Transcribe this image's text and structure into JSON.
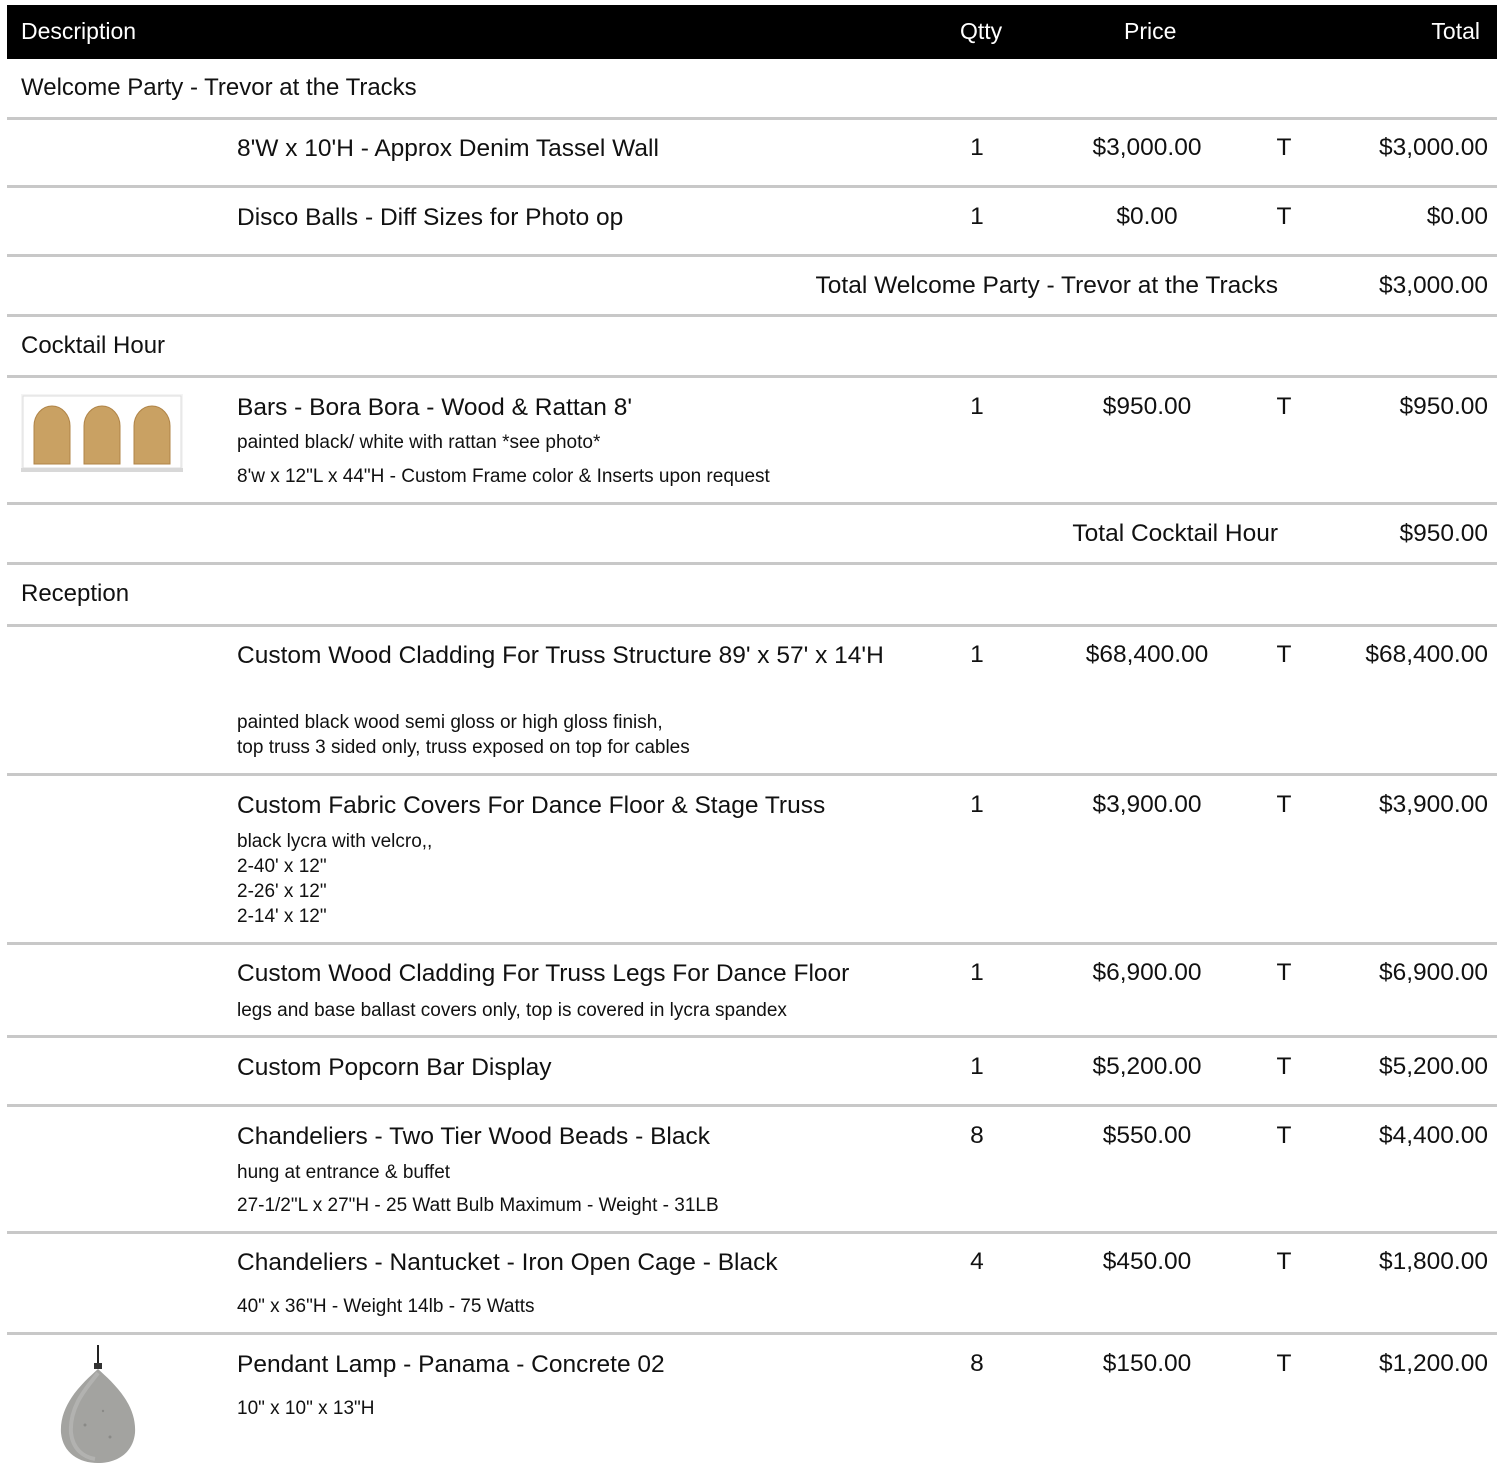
{
  "header": {
    "description": "Description",
    "qty": "Qtty",
    "price": "Price",
    "total": "Total"
  },
  "sections": [
    {
      "name": "Welcome Party - Trevor at the Tracks",
      "items": [
        {
          "title": "8'W x 10'H - Approx Denim Tassel Wall",
          "desc": [],
          "qty": "1",
          "price": "$3,000.00",
          "tax": "T",
          "total": "$3,000.00"
        },
        {
          "title": "Disco Balls - Diff Sizes for Photo op",
          "desc": [],
          "qty": "1",
          "price": "$0.00",
          "tax": "T",
          "total": "$0.00"
        }
      ],
      "subtotal_label": "Total Welcome Party - Trevor at the Tracks",
      "subtotal": "$3,000.00"
    },
    {
      "name": "Cocktail Hour",
      "items": [
        {
          "title": "Bars - Bora Bora - Wood & Rattan 8'",
          "desc": [
            "painted black/ white with rattan *see photo*",
            "8'w x 12\"L x 44\"H  - Custom Frame color & Inserts upon request"
          ],
          "qty": "1",
          "price": "$950.00",
          "tax": "T",
          "total": "$950.00",
          "image": "rattan-bar-photo"
        }
      ],
      "subtotal_label": "Total Cocktail Hour",
      "subtotal": "$950.00"
    },
    {
      "name": "Reception",
      "items": [
        {
          "title": "Custom Wood Cladding For Truss Structure 89' x 57' x 14'H",
          "desc": [
            "painted black wood semi gloss or high gloss finish,",
            "top truss 3 sided only, truss exposed on top for cables"
          ],
          "qty": "1",
          "price": "$68,400.00",
          "tax": "T",
          "total": "$68,400.00"
        },
        {
          "title": "Custom Fabric Covers For Dance Floor & Stage Truss",
          "desc": [
            "black lycra with velcro,,",
            "2-40' x 12\"",
            "2-26' x 12\"",
            "2-14' x 12\""
          ],
          "qty": "1",
          "price": "$3,900.00",
          "tax": "T",
          "total": "$3,900.00"
        },
        {
          "title": "Custom Wood Cladding For Truss Legs For Dance Floor",
          "desc": [
            "legs and base ballast covers only, top is covered in lycra spandex"
          ],
          "qty": "1",
          "price": "$6,900.00",
          "tax": "T",
          "total": "$6,900.00"
        },
        {
          "title": "Custom Popcorn Bar Display",
          "desc": [],
          "qty": "1",
          "price": "$5,200.00",
          "tax": "T",
          "total": "$5,200.00"
        },
        {
          "title": "Chandeliers - Two Tier Wood Beads - Black",
          "desc": [
            "hung at entrance & buffet",
            "27-1/2\"L x 27\"H - 25 Watt Bulb Maximum - Weight - 31LB"
          ],
          "qty": "8",
          "price": "$550.00",
          "tax": "T",
          "total": "$4,400.00"
        },
        {
          "title": "Chandeliers - Nantucket - Iron Open Cage - Black",
          "desc": [
            "40\" x 36\"H - Weight 14lb - 75 Watts"
          ],
          "qty": "4",
          "price": "$450.00",
          "tax": "T",
          "total": "$1,800.00"
        },
        {
          "title": "Pendant Lamp - Panama - Concrete 02",
          "desc": [
            "10\" x 10\" x 13\"H"
          ],
          "qty": "8",
          "price": "$150.00",
          "tax": "T",
          "total": "$1,200.00",
          "image": "pendant-lamp-photo"
        }
      ]
    }
  ]
}
